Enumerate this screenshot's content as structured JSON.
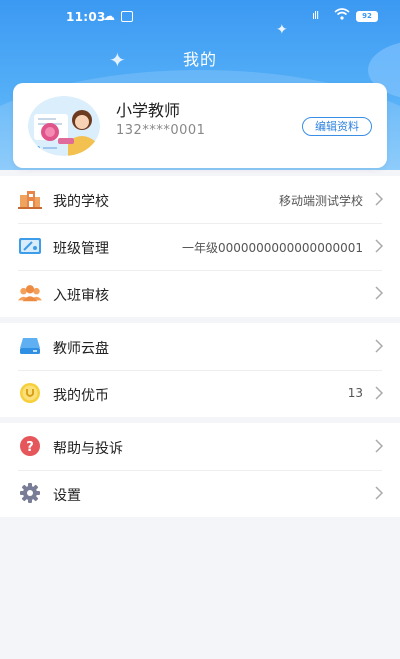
{
  "status_bar": {
    "time": "11:03",
    "signal": "5Gıll",
    "battery": "92"
  },
  "header": {
    "title": "我的"
  },
  "profile": {
    "name": "小学教师",
    "phone": "132****0001",
    "edit_label": "编辑资料"
  },
  "groups": [
    {
      "items": [
        {
          "label": "我的学校",
          "value": "移动端测试学校",
          "icon": "school-icon"
        },
        {
          "label": "班级管理",
          "value": "一年级0000000000000000001",
          "icon": "class-manage-icon"
        },
        {
          "label": "入班审核",
          "value": "",
          "icon": "people-icon"
        }
      ]
    },
    {
      "items": [
        {
          "label": "教师云盘",
          "value": "",
          "icon": "cloud-drive-icon"
        },
        {
          "label": "我的优币",
          "value": "13",
          "icon": "coin-icon"
        }
      ]
    },
    {
      "items": [
        {
          "label": "帮助与投诉",
          "value": "",
          "icon": "help-icon"
        },
        {
          "label": "设置",
          "value": "",
          "icon": "gear-icon"
        }
      ]
    }
  ],
  "colors": {
    "header_blue": "#3c99f2",
    "accent_blue": "#2f83df",
    "background": "#f4f5f9"
  }
}
